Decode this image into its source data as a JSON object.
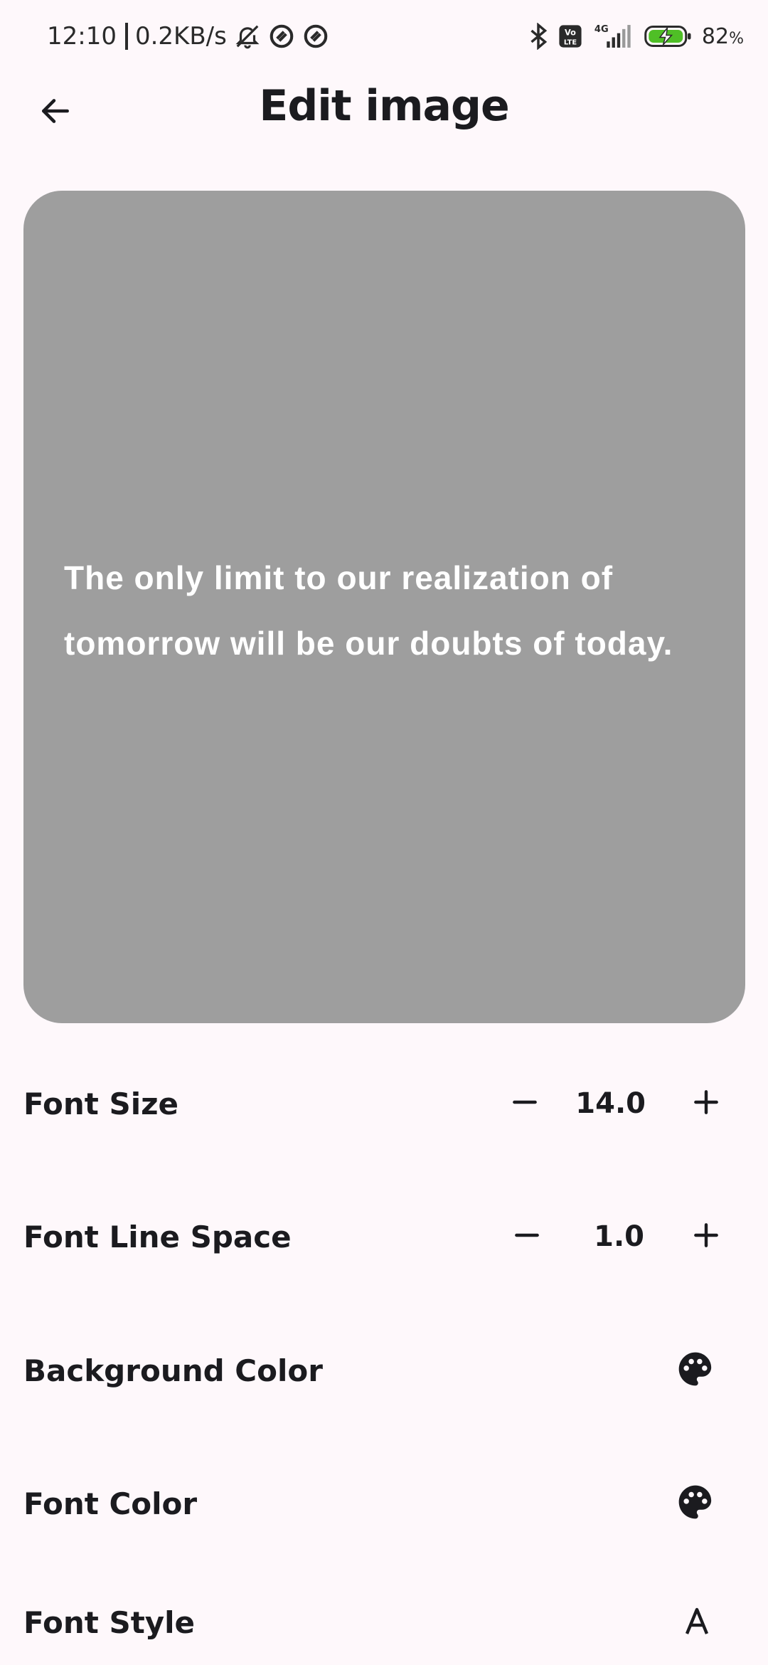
{
  "status_bar": {
    "time": "12:10",
    "net_speed": "0.2KB/s",
    "network": "4G",
    "volte": "Vo LTE",
    "battery_percent": "82",
    "battery_unit": "%"
  },
  "app_bar": {
    "title": "Edit image",
    "back_icon": "arrow-back-icon"
  },
  "preview": {
    "background_color": "#9e9e9e",
    "text_color": "#ffffff",
    "quote": "The only limit to our realization of tomorrow will be our doubts of today."
  },
  "settings": {
    "font_size": {
      "label": "Font Size",
      "value": "14.0",
      "decrement_icon": "minus-icon",
      "increment_icon": "plus-icon"
    },
    "font_line_space": {
      "label": "Font Line Space",
      "value": "1.0",
      "decrement_icon": "minus-icon",
      "increment_icon": "plus-icon"
    },
    "background_color": {
      "label": "Background Color",
      "icon": "palette-icon"
    },
    "font_color": {
      "label": "Font Color",
      "icon": "palette-icon"
    },
    "font_style": {
      "label": "Font Style",
      "icon": "font-style-icon"
    }
  }
}
